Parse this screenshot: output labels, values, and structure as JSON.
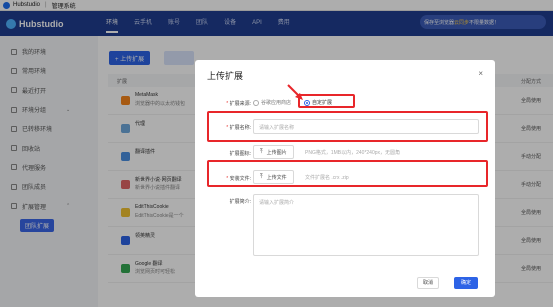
{
  "titlebar": {
    "app_name": "Hubstudio",
    "separator": "|",
    "section": "管理系统"
  },
  "header": {
    "brand": "Hubstudio",
    "nav": [
      {
        "label": "环境",
        "active": true
      },
      {
        "label": "云手机",
        "active": false
      },
      {
        "label": "账号",
        "active": false
      },
      {
        "label": "团队",
        "active": false
      },
      {
        "label": "设备",
        "active": false
      },
      {
        "label": "API",
        "active": false
      },
      {
        "label": "费用",
        "active": false
      }
    ],
    "promo_text": "保存至浏览器",
    "promo_highlight": "云同步",
    "promo_tail": "不限量数据！"
  },
  "sidebar": {
    "items": [
      {
        "label": "我的环境"
      },
      {
        "label": "常用环境"
      },
      {
        "label": "最近打开"
      },
      {
        "label": "环境分组",
        "chevron": "⌄"
      },
      {
        "label": "已转移环境"
      },
      {
        "label": "回收站"
      },
      {
        "label": "代理服务"
      },
      {
        "label": "团队成员"
      },
      {
        "label": "扩展管理",
        "chevron": "⌃"
      }
    ],
    "sub_item": "团队扩展"
  },
  "content": {
    "upload_button": "+ 上传扩展",
    "header_col1": "扩展",
    "header_col2": "分配方式",
    "rows": [
      {
        "name": "MetaMask",
        "desc": "浏览器中的以太坊钱包",
        "type": "全局使用",
        "color": "#f6851b"
      },
      {
        "name": "代理",
        "desc": "",
        "type": "全局使用",
        "color": "#6fa8dc"
      },
      {
        "name": "翻译插件",
        "desc": "",
        "type": "手动分配",
        "color": "#4a90e2"
      },
      {
        "name": "新世界小说·网页翻译",
        "desc": "新世界小说插件翻译",
        "type": "手动分配",
        "color": "#e06666"
      },
      {
        "name": "EditThisCookie",
        "desc": "EditThisCookie是一个",
        "type": "全局使用",
        "color": "#f1c232"
      },
      {
        "name": "领英精灵",
        "desc": "",
        "type": "全局使用",
        "color": "#2d63e6"
      },
      {
        "name": "Google 翻译",
        "desc": "浏览网页时可轻松",
        "type": "全局使用",
        "color": "#34a853"
      }
    ]
  },
  "modal": {
    "title": "上传扩展",
    "close": "×",
    "source_label": "扩展来源:",
    "source_options": [
      {
        "label": "谷歌应用商店",
        "selected": false
      },
      {
        "label": "自定扩展",
        "selected": true
      }
    ],
    "name_label": "扩展名称:",
    "name_placeholder": "请输入扩展名称",
    "icon_label": "扩展图标:",
    "icon_button": "上传图片",
    "icon_hint": "PNG格式，1MB以内，240*240px，无圆角",
    "file_label": "安装文件:",
    "file_button": "上传文件",
    "file_hint": "文件扩展名 .crx .zip",
    "intro_label": "扩展简介:",
    "intro_placeholder": "请输入扩展简介",
    "cancel": "取消",
    "ok": "确定"
  },
  "colors": {
    "primary": "#2d63e6",
    "header": "#1f3d8f",
    "annotation": "#e8262a"
  }
}
